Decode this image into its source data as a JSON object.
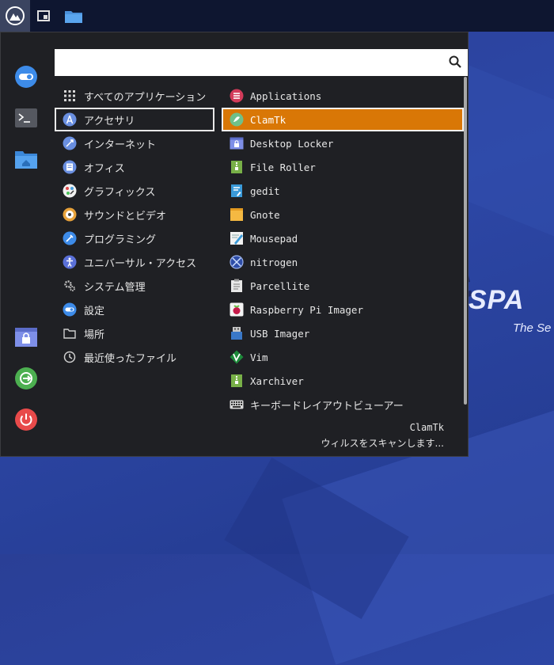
{
  "desktop": {
    "brand": "SPA",
    "tagline": "The Se"
  },
  "search": {
    "value": "",
    "placeholder": ""
  },
  "categories": [
    {
      "label": "すべてのアプリケーション",
      "icon": "grid-icon"
    },
    {
      "label": "アクセサリ",
      "icon": "accessories-icon",
      "selected": true
    },
    {
      "label": "インターネット",
      "icon": "internet-icon"
    },
    {
      "label": "オフィス",
      "icon": "office-icon"
    },
    {
      "label": "グラフィックス",
      "icon": "graphics-icon"
    },
    {
      "label": "サウンドとビデオ",
      "icon": "multimedia-icon"
    },
    {
      "label": "プログラミング",
      "icon": "programming-icon"
    },
    {
      "label": "ユニバーサル・アクセス",
      "icon": "accessibility-icon"
    },
    {
      "label": "システム管理",
      "icon": "system-gear-icon"
    },
    {
      "label": "設定",
      "icon": "settings-icon"
    },
    {
      "label": "場所",
      "icon": "folder-icon"
    },
    {
      "label": "最近使ったファイル",
      "icon": "clock-icon"
    }
  ],
  "apps": [
    {
      "label": "Applications",
      "icon": "applications-icon"
    },
    {
      "label": "ClamTk",
      "icon": "clamtk-icon",
      "highlighted": true
    },
    {
      "label": "Desktop Locker",
      "icon": "desktop-locker-icon"
    },
    {
      "label": "File Roller",
      "icon": "file-roller-icon"
    },
    {
      "label": "gedit",
      "icon": "gedit-icon"
    },
    {
      "label": "Gnote",
      "icon": "gnote-icon"
    },
    {
      "label": "Mousepad",
      "icon": "mousepad-icon"
    },
    {
      "label": "nitrogen",
      "icon": "nitrogen-icon"
    },
    {
      "label": "Parcellite",
      "icon": "parcellite-icon"
    },
    {
      "label": "Raspberry Pi Imager",
      "icon": "raspberry-pi-icon"
    },
    {
      "label": "USB Imager",
      "icon": "usb-imager-icon"
    },
    {
      "label": "Vim",
      "icon": "vim-icon"
    },
    {
      "label": "Xarchiver",
      "icon": "xarchiver-icon"
    },
    {
      "label": "キーボードレイアウトビューアー",
      "icon": "keyboard-icon"
    }
  ],
  "description": {
    "title": "ClamTk",
    "text": "ウィルスをスキャンします..."
  },
  "colors": {
    "highlight": "#d97706",
    "menu_bg": "#1f2024",
    "taskbar_bg": "#0e1630"
  }
}
